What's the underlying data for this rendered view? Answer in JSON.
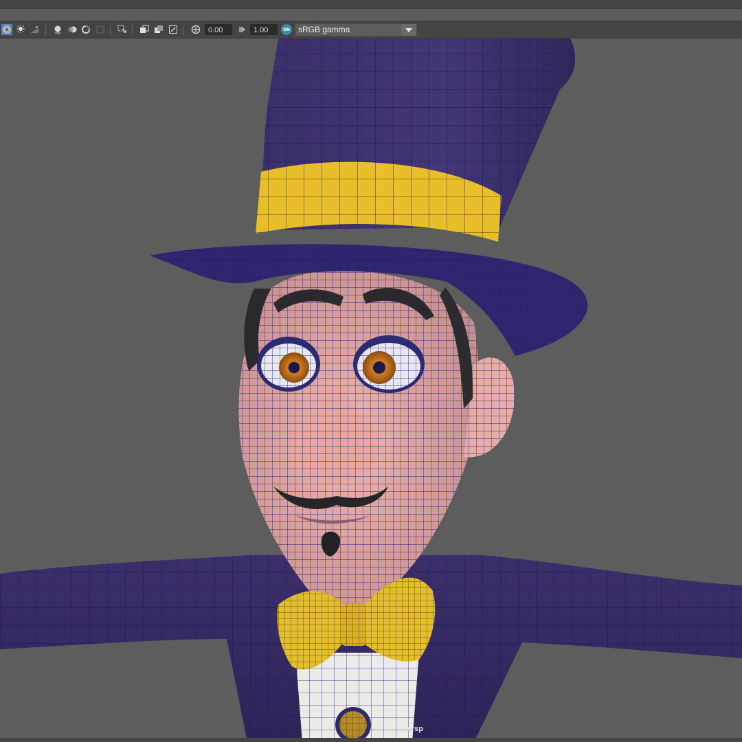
{
  "toolbar": {
    "exposure_value": "0.00",
    "gamma_value": "1.00",
    "color_management_toggle": "ON",
    "view_transform": "sRGB gamma"
  },
  "viewport": {
    "camera_label": "persp"
  },
  "icons": [
    "wireframe-on-shaded-icon",
    "lights-icon",
    "shadows-icon",
    "ambient-occlusion-icon",
    "motion-blur-icon",
    "anti-aliasing-icon",
    "depth-of-field-icon",
    "isolate-select-icon",
    "xray-icon",
    "xray-active-components-icon",
    "xray-joints-icon",
    "exposure-icon",
    "gamma-icon",
    "color-management-icon",
    "dropdown-arrow-icon"
  ]
}
